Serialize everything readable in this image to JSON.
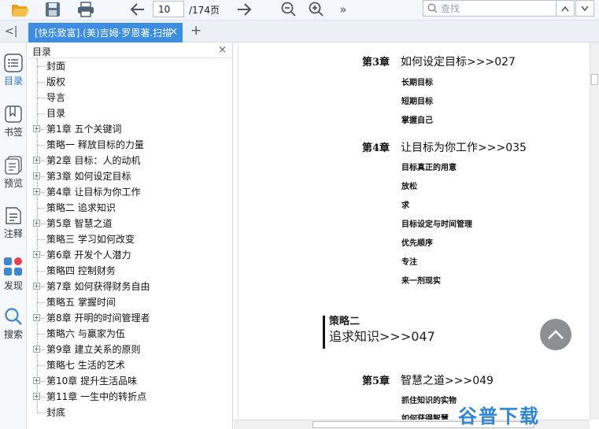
{
  "toolbar": {
    "page_current": "10",
    "page_total": "/174页",
    "search_placeholder": "查找",
    "more_label": "»"
  },
  "tabs": {
    "collapse_label": "<|",
    "active_tab": "[快乐致富].(美)吉姆·罗恩著.扫描",
    "close_label": "×",
    "add_label": "+"
  },
  "rail": [
    {
      "label": "目录",
      "icon": "toc-icon"
    },
    {
      "label": "书签",
      "icon": "bookmark-icon"
    },
    {
      "label": "预览",
      "icon": "preview-icon"
    },
    {
      "label": "注释",
      "icon": "annotation-icon"
    },
    {
      "label": "发现",
      "icon": "discover-icon"
    },
    {
      "label": "搜索",
      "icon": "search-icon"
    }
  ],
  "toc": {
    "title": "目录",
    "close_label": "×",
    "items": [
      {
        "label": "封面",
        "expandable": false
      },
      {
        "label": "版权",
        "expandable": false
      },
      {
        "label": "导言",
        "expandable": false
      },
      {
        "label": "目录",
        "expandable": false
      },
      {
        "label": "第1章 五个关键词",
        "expandable": true
      },
      {
        "label": "策略一 释放目标的力量",
        "expandable": false
      },
      {
        "label": "第2章 目标：人的动机",
        "expandable": true
      },
      {
        "label": "第3章 如何设定目标",
        "expandable": true
      },
      {
        "label": "第4章 让目标为你工作",
        "expandable": true
      },
      {
        "label": "策略二 追求知识",
        "expandable": false
      },
      {
        "label": "第5章 智慧之道",
        "expandable": true
      },
      {
        "label": "策略三 学习如何改变",
        "expandable": false
      },
      {
        "label": "第6章 开发个人潜力",
        "expandable": true
      },
      {
        "label": "策略四 控制财务",
        "expandable": false
      },
      {
        "label": "第7章 如何获得财务自由",
        "expandable": true
      },
      {
        "label": "策略五 掌握时间",
        "expandable": false
      },
      {
        "label": "第8章 开明的时间管理者",
        "expandable": true
      },
      {
        "label": "策略六 与赢家为伍",
        "expandable": false
      },
      {
        "label": "第9章 建立关系的原则",
        "expandable": true
      },
      {
        "label": "策略七 生活的艺术",
        "expandable": false
      },
      {
        "label": "第10章 提升生活品味",
        "expandable": true
      },
      {
        "label": "第11章 一生中的转折点",
        "expandable": true
      },
      {
        "label": "封底",
        "expandable": false
      }
    ]
  },
  "document": {
    "ch3": {
      "num": "第3章",
      "title": "如何设定目标>>>027"
    },
    "ch3_subs": [
      "长期目标",
      "短期目标",
      "掌握自己"
    ],
    "ch4": {
      "num": "第4章",
      "title": "让目标为你工作>>>035"
    },
    "ch4_subs": [
      "目标真正的用意",
      "放松",
      "求",
      "目标设定与时间管理",
      "优先顺序",
      "专注",
      "来一剂现实"
    ],
    "strategy": {
      "label": "策略二",
      "title": "追求知识>>>047"
    },
    "ch5": {
      "num": "第5章",
      "title": "智慧之道>>>049"
    },
    "ch5_subs": [
      "抓住知识的实物",
      "如何获得智慧"
    ]
  },
  "watermark": "谷普下载"
}
